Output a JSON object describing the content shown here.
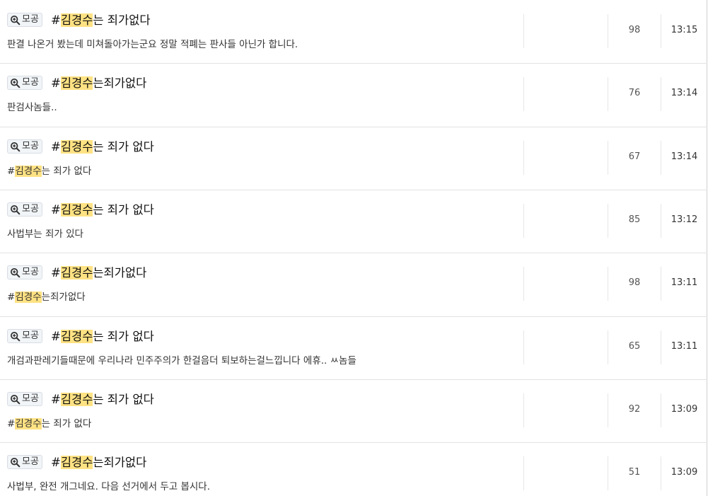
{
  "board_tag": "모공",
  "rows": [
    {
      "title_prefix": "#",
      "title_highlight": "김경수",
      "title_suffix": "는 죄가없다",
      "excerpt_prefix": "판결 나온거 봤는데 미쳐돌아가는군요 정말 적폐는 판사들 아닌가 합니다.",
      "excerpt_highlight": "",
      "excerpt_suffix": "",
      "views": "98",
      "time": "13:15"
    },
    {
      "title_prefix": "#",
      "title_highlight": "김경수",
      "title_suffix": "는죄가없다",
      "excerpt_prefix": "판검사놈들..",
      "excerpt_highlight": "",
      "excerpt_suffix": "",
      "views": "76",
      "time": "13:14"
    },
    {
      "title_prefix": "#",
      "title_highlight": "김경수",
      "title_suffix": "는 죄가 없다",
      "excerpt_prefix": "#",
      "excerpt_highlight": "김경수",
      "excerpt_suffix": "는 죄가 없다",
      "views": "67",
      "time": "13:14"
    },
    {
      "title_prefix": "#",
      "title_highlight": "김경수",
      "title_suffix": "는 죄가 없다",
      "excerpt_prefix": "사법부는 죄가 있다",
      "excerpt_highlight": "",
      "excerpt_suffix": "",
      "views": "85",
      "time": "13:12"
    },
    {
      "title_prefix": "#",
      "title_highlight": "김경수",
      "title_suffix": "는죄가없다",
      "excerpt_prefix": "#",
      "excerpt_highlight": "김경수",
      "excerpt_suffix": "는죄가없다",
      "views": "98",
      "time": "13:11"
    },
    {
      "title_prefix": "#",
      "title_highlight": "김경수",
      "title_suffix": "는 죄가 없다",
      "excerpt_prefix": "개검과판레기들때문에 우리나라 민주주의가 한걸음더 퇴보하는걸느낍니다 에휴.. ㅆ놈들",
      "excerpt_highlight": "",
      "excerpt_suffix": "",
      "views": "65",
      "time": "13:11"
    },
    {
      "title_prefix": "#",
      "title_highlight": "김경수",
      "title_suffix": "는 죄가 없다",
      "excerpt_prefix": "#",
      "excerpt_highlight": "김경수",
      "excerpt_suffix": "는 죄가 없다",
      "views": "92",
      "time": "13:09"
    },
    {
      "title_prefix": "#",
      "title_highlight": "김경수",
      "title_suffix": "는죄가없다",
      "excerpt_prefix": "사법부, 완전 개그네요. 다음 선거에서 두고 봅시다.",
      "excerpt_highlight": "",
      "excerpt_suffix": "",
      "views": "51",
      "time": "13:09"
    }
  ]
}
